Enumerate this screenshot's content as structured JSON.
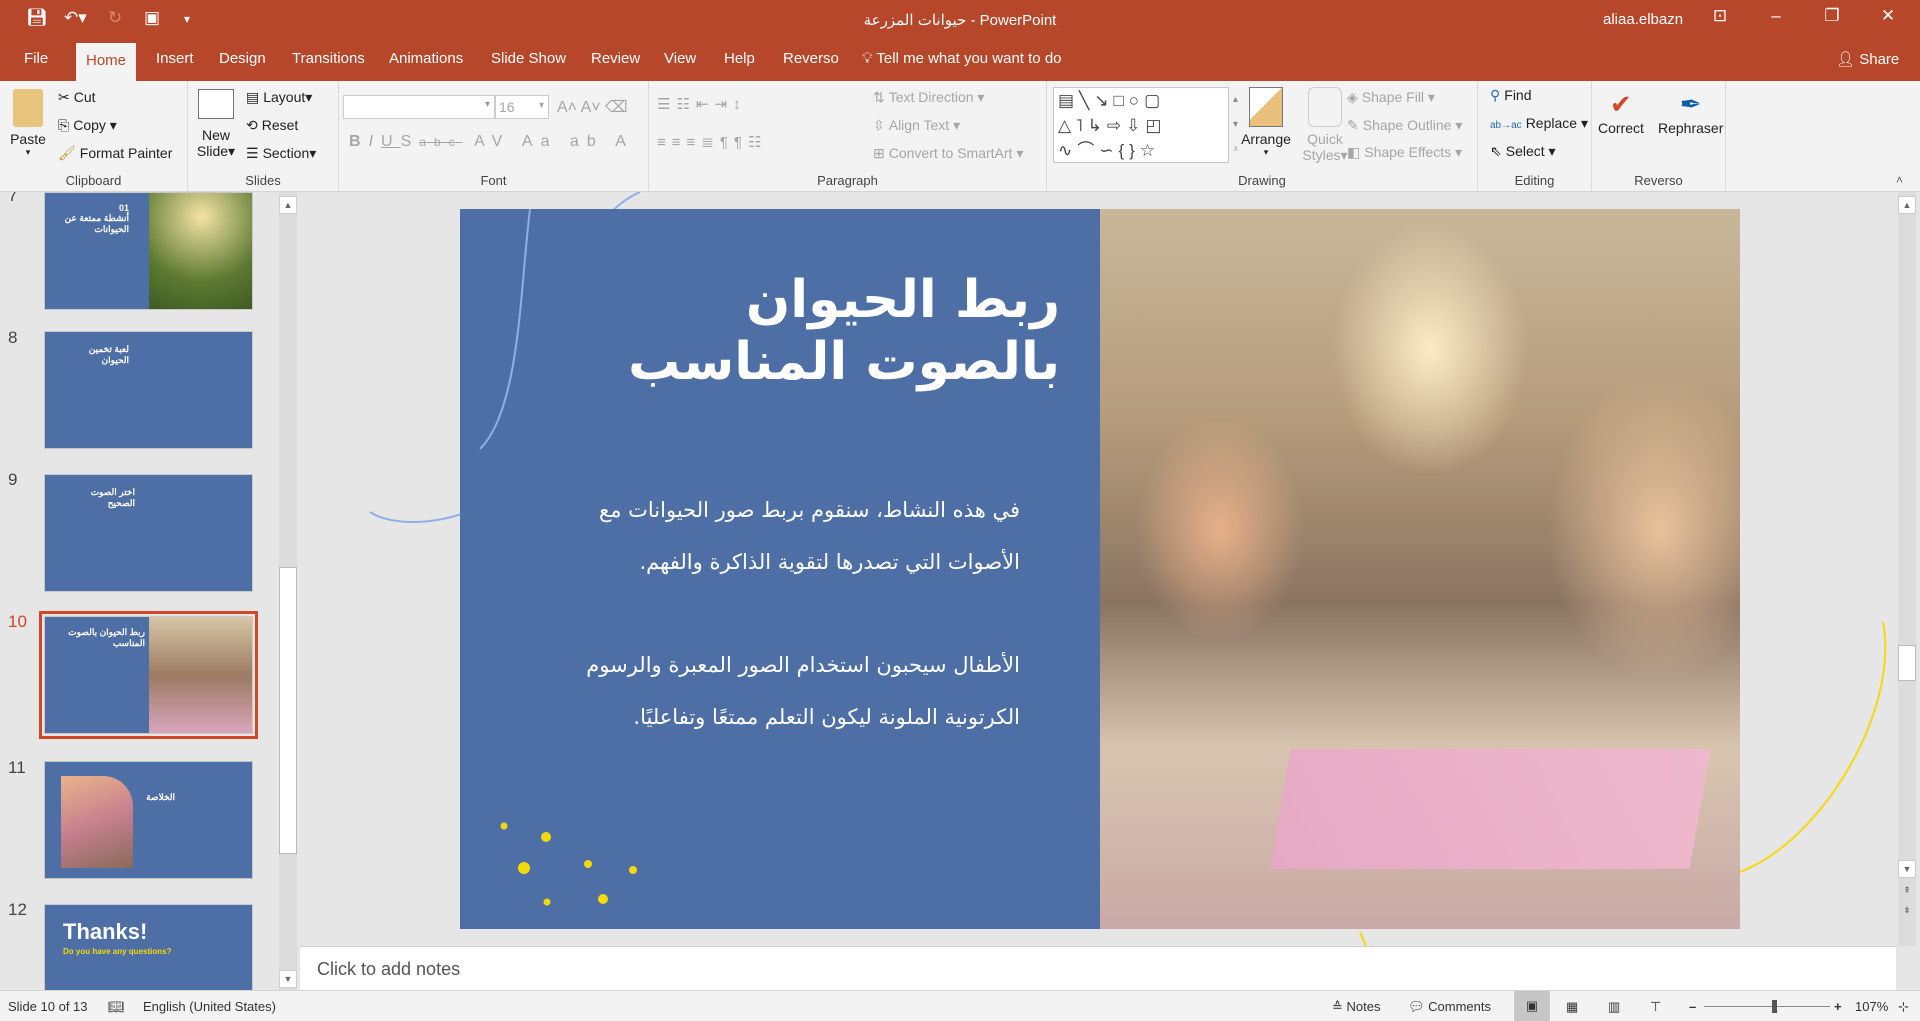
{
  "window": {
    "doc_title": "حيوانات المزرعة",
    "separator": " - ",
    "app_name": "PowerPoint",
    "user": "aliaa.elbazn",
    "share_label": "Share",
    "tell_me": "Tell me what you want to do"
  },
  "tabs": [
    "File",
    "Home",
    "Insert",
    "Design",
    "Transitions",
    "Animations",
    "Slide Show",
    "Review",
    "View",
    "Help",
    "Reverso"
  ],
  "ribbon": {
    "clipboard": {
      "label": "Clipboard",
      "paste": "Paste",
      "cut": "Cut",
      "copy": "Copy",
      "format_painter": "Format Painter"
    },
    "slides": {
      "label": "Slides",
      "new_slide_1": "New",
      "new_slide_2": "Slide",
      "layout": "Layout",
      "reset": "Reset",
      "section": "Section"
    },
    "font": {
      "label": "Font",
      "font_name": "",
      "font_size": "16"
    },
    "paragraph": {
      "label": "Paragraph",
      "text_direction": "Text Direction",
      "align_text": "Align Text",
      "convert_smartart": "Convert to SmartArt"
    },
    "drawing": {
      "label": "Drawing",
      "arrange": "Arrange",
      "quick_1": "Quick",
      "quick_2": "Styles",
      "shape_fill": "Shape Fill",
      "shape_outline": "Shape Outline",
      "shape_effects": "Shape Effects"
    },
    "editing": {
      "label": "Editing",
      "find": "Find",
      "replace": "Replace",
      "select": "Select"
    },
    "reverso": {
      "label": "Reverso",
      "correct": "Correct",
      "rephraser": "Rephraser"
    }
  },
  "thumbnails": [
    {
      "num": "7",
      "title": "01\nأنشطة ممتعة عن الحيوانات"
    },
    {
      "num": "8",
      "title": "لعبة تخمين الحيوان"
    },
    {
      "num": "9",
      "title": "اختر الصوت الصحيح"
    },
    {
      "num": "10",
      "title": "ربط الحيوان بالصوت المناسب",
      "selected": true
    },
    {
      "num": "11",
      "title": "الخلاصة"
    },
    {
      "num": "12",
      "title": "Thanks!",
      "subtitle": "Do you have any questions?"
    }
  ],
  "slide": {
    "title": "ربط الحيوان بالصوت المناسب",
    "para1": "في هذه النشاط، سنقوم بربط صور الحيوانات مع الأصوات التي تصدرها لتقوية الذاكرة والفهم.",
    "para2": "الأطفال سيحبون استخدام الصور المعبرة والرسوم الكرتونية الملونة ليكون التعلم ممتعًا وتفاعليًا.",
    "background_color": "#4e6ea6",
    "accent_color": "#f5d90a"
  },
  "notes_placeholder": "Click to add notes",
  "status": {
    "slide_info": "Slide 10 of 13",
    "language": "English (United States)",
    "notes": "Notes",
    "comments": "Comments",
    "zoom": "107%",
    "zoom_percent": 107
  },
  "theme": {
    "ribbon_accent": "#b7472a"
  }
}
